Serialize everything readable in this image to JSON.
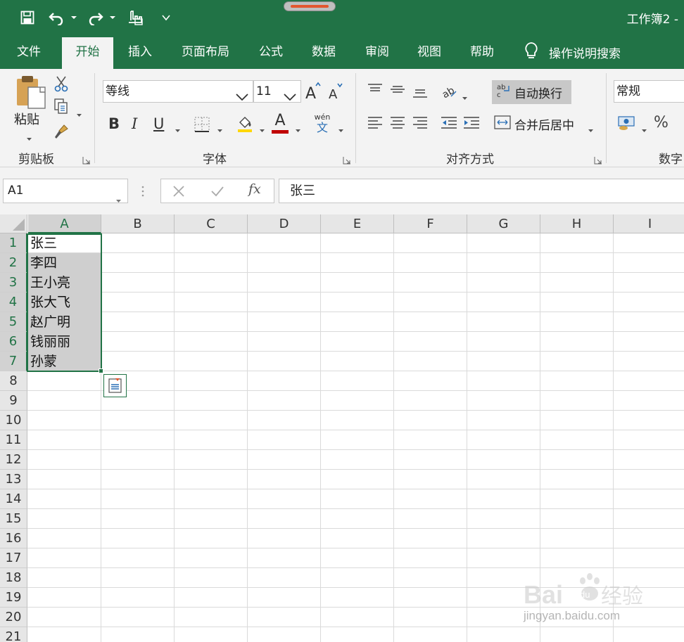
{
  "app": {
    "title": "工作簿2 -",
    "accent": "#217346"
  },
  "quick_access": {
    "icons": [
      "save-icon",
      "undo-icon",
      "redo-icon",
      "touch-mode-icon",
      "customize-icon"
    ]
  },
  "tabs": [
    {
      "label": "文件"
    },
    {
      "label": "开始",
      "active": true
    },
    {
      "label": "插入"
    },
    {
      "label": "页面布局"
    },
    {
      "label": "公式"
    },
    {
      "label": "数据"
    },
    {
      "label": "审阅"
    },
    {
      "label": "视图"
    },
    {
      "label": "帮助"
    }
  ],
  "tell_me": "操作说明搜索",
  "ribbon": {
    "clipboard": {
      "paste": "粘贴",
      "label": "剪贴板"
    },
    "font": {
      "name": "等线",
      "size": "11",
      "bold": "B",
      "italic": "I",
      "underline": "U",
      "font_color": "A",
      "phonetic_top": "wén",
      "phonetic_bottom": "文",
      "label": "字体"
    },
    "alignment": {
      "wrap_text": "自动换行",
      "merge_center": "合并后居中",
      "label": "对齐方式"
    },
    "number": {
      "format": "常规",
      "percent": "%",
      "label": "数字"
    }
  },
  "formula_bar": {
    "name_box": "A1",
    "fx": "fx",
    "content": "张三"
  },
  "sheet": {
    "columns": [
      "A",
      "B",
      "C",
      "D",
      "E",
      "F",
      "G",
      "H",
      "I"
    ],
    "rows": [
      "1",
      "2",
      "3",
      "4",
      "5",
      "6",
      "7",
      "8",
      "9",
      "10",
      "11",
      "12",
      "13",
      "14",
      "15",
      "16",
      "17",
      "18",
      "19",
      "20",
      "21"
    ],
    "cells_A": [
      "张三",
      "李四",
      "王小亮",
      "张大飞",
      "赵广明",
      "钱丽丽",
      "孙蒙"
    ],
    "selected_column": "A",
    "selected_rows": [
      "1",
      "2",
      "3",
      "4",
      "5",
      "6",
      "7"
    ]
  },
  "watermark": {
    "brand": "Bai du 经验",
    "site": "jingyan.baidu.com"
  }
}
